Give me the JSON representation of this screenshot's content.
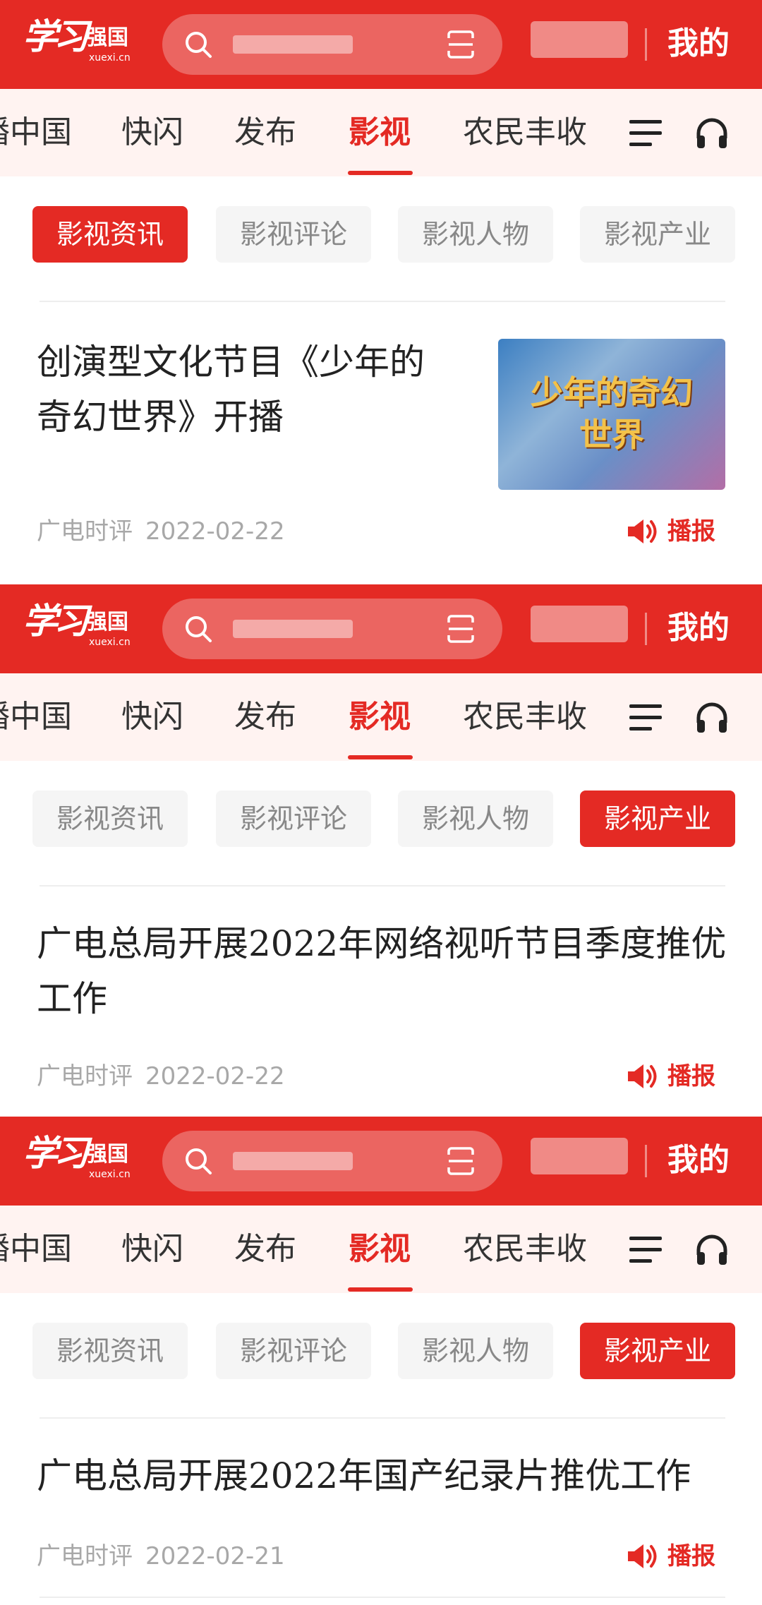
{
  "brand": {
    "logo_main": "学习",
    "logo_side": "强国",
    "logo_url": "xuexi.cn"
  },
  "header": {
    "mine_label": "我的"
  },
  "nav": {
    "tabs": [
      {
        "label": "播中国"
      },
      {
        "label": "快闪"
      },
      {
        "label": "发布"
      },
      {
        "label": "影视",
        "active": true
      },
      {
        "label": "农民丰收"
      }
    ]
  },
  "subtabs": [
    {
      "label": "影视资讯"
    },
    {
      "label": "影视评论"
    },
    {
      "label": "影视人物"
    },
    {
      "label": "影视产业"
    }
  ],
  "screens": [
    {
      "active_subtab": 0,
      "article": {
        "title": "创演型文化节目《少年的奇幻世界》开播",
        "thumbnail_text": "少年的奇幻世界",
        "source": "广电时评",
        "date": "2022-02-22",
        "play_label": "播报"
      }
    },
    {
      "active_subtab": 3,
      "article": {
        "title": "广电总局开展2022年网络视听节目季度推优工作",
        "source": "广电时评",
        "date": "2022-02-22",
        "play_label": "播报"
      }
    },
    {
      "active_subtab": 3,
      "article": {
        "title": "广电总局开展2022年国产纪录片推优工作",
        "source": "广电时评",
        "date": "2022-02-21",
        "play_label": "播报"
      }
    }
  ],
  "colors": {
    "brand_red": "#e42a24",
    "nav_bg": "#fff3f1",
    "chip_bg": "#f5f5f5",
    "meta_gray": "#a8a8a8"
  },
  "icons": {
    "search": "search-icon",
    "scan": "scan-icon",
    "menu": "menu-icon",
    "listen": "headphones-icon",
    "speaker": "speaker-icon"
  }
}
